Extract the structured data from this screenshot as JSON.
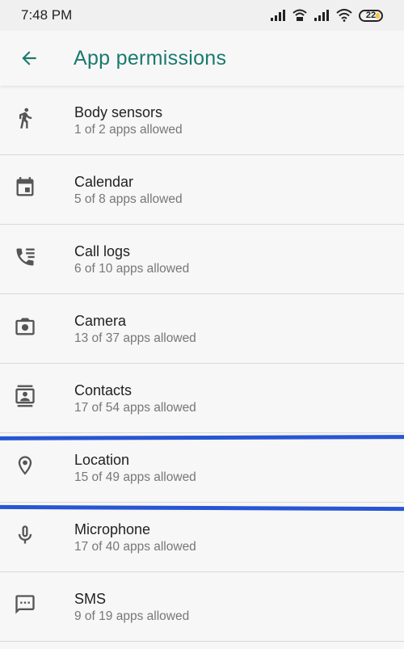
{
  "status_bar": {
    "time": "7:48 PM",
    "battery": "22"
  },
  "app_bar": {
    "title": "App permissions"
  },
  "permissions": [
    {
      "name": "Body sensors",
      "allowed": "1 of 2 apps allowed",
      "icon": "body-sensors-icon"
    },
    {
      "name": "Calendar",
      "allowed": "5 of 8 apps allowed",
      "icon": "calendar-icon"
    },
    {
      "name": "Call logs",
      "allowed": "6 of 10 apps allowed",
      "icon": "call-log-icon"
    },
    {
      "name": "Camera",
      "allowed": "13 of 37 apps allowed",
      "icon": "camera-icon"
    },
    {
      "name": "Contacts",
      "allowed": "17 of 54 apps allowed",
      "icon": "contacts-icon"
    },
    {
      "name": "Location",
      "allowed": "15 of 49 apps allowed",
      "icon": "location-icon"
    },
    {
      "name": "Microphone",
      "allowed": "17 of 40 apps allowed",
      "icon": "microphone-icon"
    },
    {
      "name": "SMS",
      "allowed": "9 of 19 apps allowed",
      "icon": "sms-icon"
    }
  ],
  "colors": {
    "accent": "#1a7a6e",
    "highlight": "#2756d4",
    "icon": "#555555"
  }
}
